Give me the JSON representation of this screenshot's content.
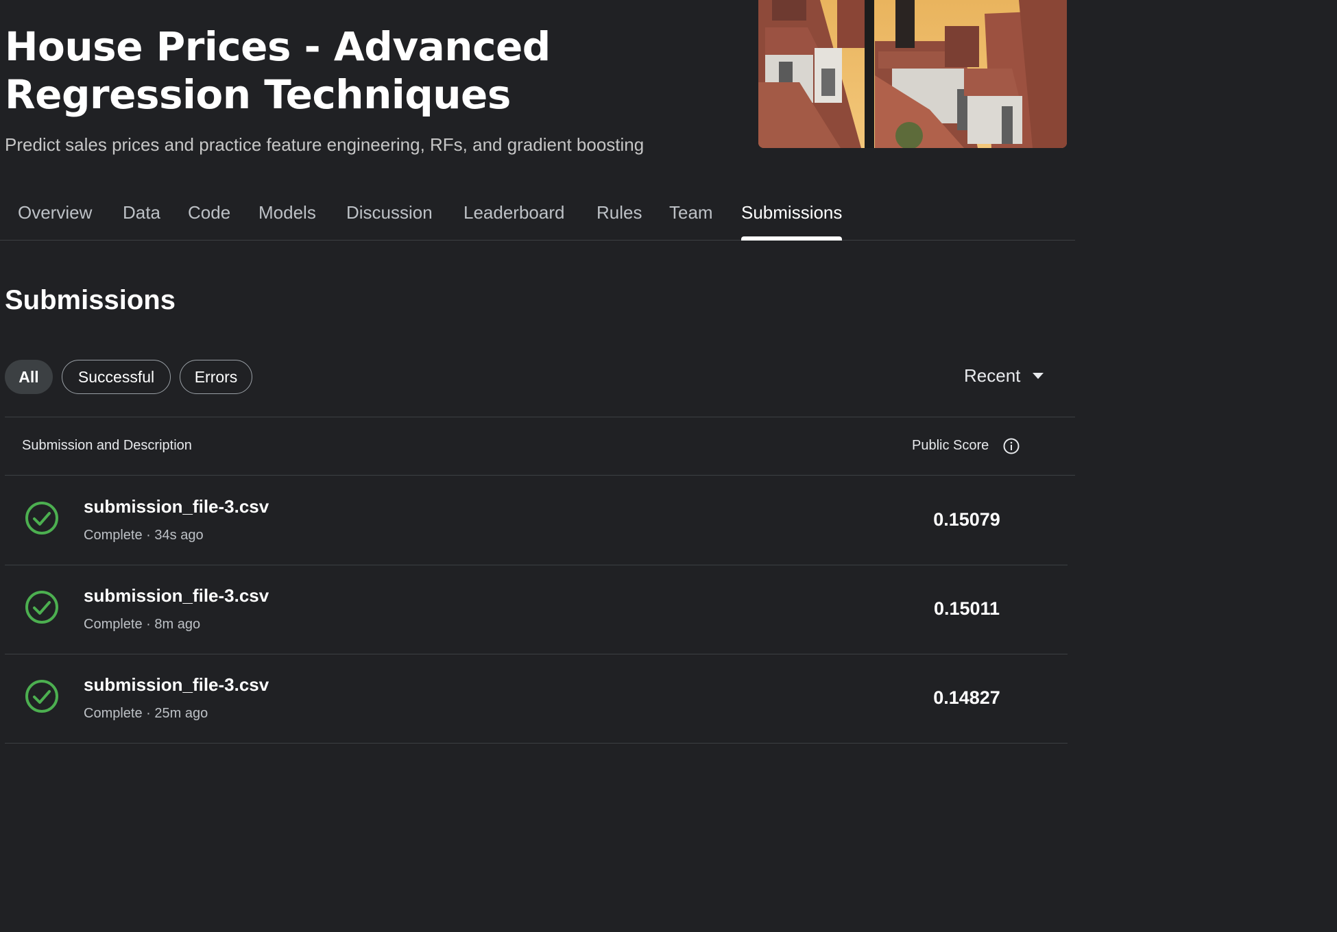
{
  "header": {
    "title": "House Prices - Advanced Regression Techniques",
    "subtitle": "Predict sales prices and practice feature engineering, RFs, and gradient boosting"
  },
  "tabs": [
    {
      "label": "Overview",
      "active": false
    },
    {
      "label": "Data",
      "active": false
    },
    {
      "label": "Code",
      "active": false
    },
    {
      "label": "Models",
      "active": false
    },
    {
      "label": "Discussion",
      "active": false
    },
    {
      "label": "Leaderboard",
      "active": false
    },
    {
      "label": "Rules",
      "active": false
    },
    {
      "label": "Team",
      "active": false
    },
    {
      "label": "Submissions",
      "active": true
    }
  ],
  "section_title": "Submissions",
  "filters": [
    {
      "label": "All",
      "selected": true
    },
    {
      "label": "Successful",
      "selected": false
    },
    {
      "label": "Errors",
      "selected": false
    }
  ],
  "sort": {
    "label": "Recent",
    "icon": "caret-down-icon"
  },
  "table": {
    "col_submission": "Submission and Description",
    "col_score": "Public Score",
    "score_info_icon": "info-icon",
    "rows": [
      {
        "file": "submission_file-3.csv",
        "status": "Complete",
        "time": "34s ago",
        "score": "0.15079",
        "icon": "check-circle-icon"
      },
      {
        "file": "submission_file-3.csv",
        "status": "Complete",
        "time": "8m ago",
        "score": "0.15011",
        "icon": "check-circle-icon"
      },
      {
        "file": "submission_file-3.csv",
        "status": "Complete",
        "time": "25m ago",
        "score": "0.14827",
        "icon": "check-circle-icon"
      }
    ]
  },
  "colors": {
    "background": "#202124",
    "success": "#4caf50",
    "divider": "#3c4043"
  }
}
